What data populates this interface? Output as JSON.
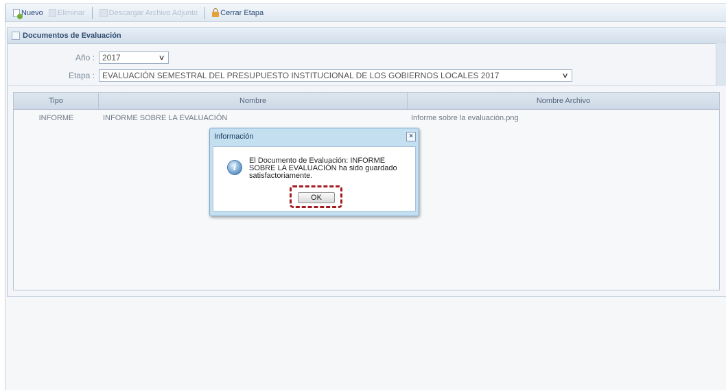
{
  "toolbar": {
    "nuevo": "Nuevo",
    "eliminar": "Eliminar",
    "descargar": "Descargar Archivo Adjunto",
    "cerrar": "Cerrar Etapa"
  },
  "panel": {
    "title": "Documentos de Evaluación",
    "anio_label": "Año :",
    "anio_value": "2017",
    "etapa_label": "Etapa :",
    "etapa_value": "EVALUACIÓN SEMESTRAL DEL PRESUPUESTO INSTITUCIONAL DE LOS GOBIERNOS LOCALES 2017"
  },
  "grid": {
    "columns": [
      "Tipo",
      "Nombre",
      "Nombre Archivo"
    ],
    "rows": [
      {
        "tipo": "INFORME",
        "nombre": "INFORME SOBRE LA EVALUACIÓN",
        "archivo": "Informe sobre la evaluación.png"
      }
    ]
  },
  "dialog": {
    "title": "Información",
    "close": "×",
    "icon": "i",
    "message": "El Documento de Evaluación: INFORME SOBRE LA EVALUACIÓN ha sido guardado satisfactoriamente.",
    "ok": "OK"
  },
  "colors": {
    "highlight": "#a21a22",
    "dialog_frame": "#c4dff0"
  }
}
